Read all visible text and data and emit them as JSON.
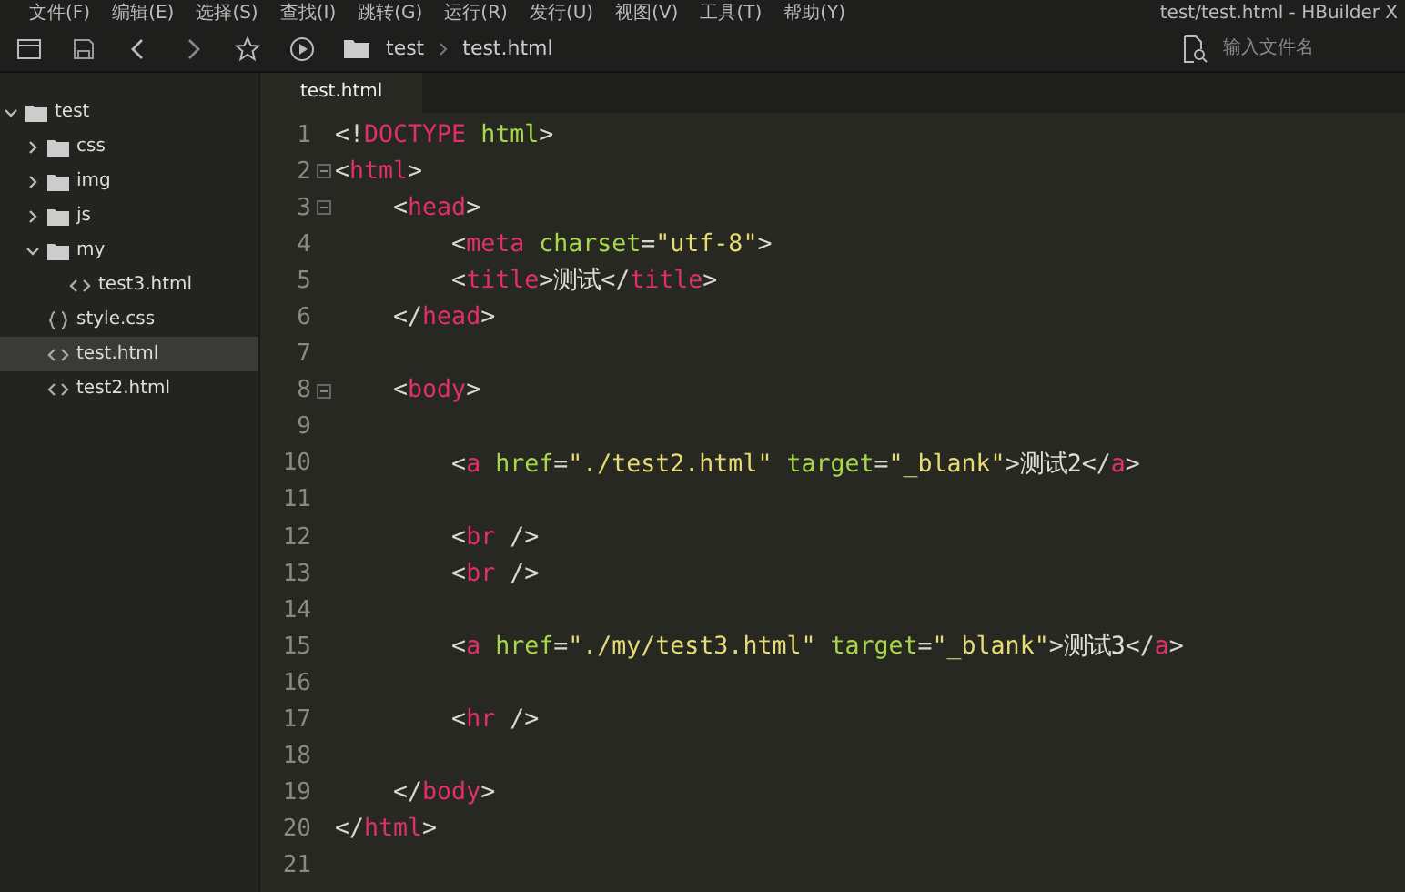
{
  "window": {
    "title": "test/test.html - HBuilder X"
  },
  "menu": [
    "文件(F)",
    "编辑(E)",
    "选择(S)",
    "查找(I)",
    "跳转(G)",
    "运行(R)",
    "发行(U)",
    "视图(V)",
    "工具(T)",
    "帮助(Y)"
  ],
  "toolbar": {
    "breadcrumb": [
      "test",
      "test.html"
    ],
    "search": {
      "placeholder": "输入文件名"
    }
  },
  "sidebar": {
    "items": [
      {
        "label": "test",
        "kind": "folder",
        "expanded": true,
        "selected": false,
        "children": [
          {
            "label": "css",
            "kind": "folder",
            "expanded": false,
            "selected": false
          },
          {
            "label": "img",
            "kind": "folder",
            "expanded": false,
            "selected": false
          },
          {
            "label": "js",
            "kind": "folder",
            "expanded": false,
            "selected": false
          },
          {
            "label": "my",
            "kind": "folder",
            "expanded": true,
            "selected": false,
            "children": [
              {
                "label": "test3.html",
                "kind": "html",
                "selected": false
              }
            ]
          },
          {
            "label": "style.css",
            "kind": "css",
            "selected": false
          },
          {
            "label": "test.html",
            "kind": "html",
            "selected": true
          },
          {
            "label": "test2.html",
            "kind": "html",
            "selected": false
          }
        ]
      }
    ]
  },
  "tabs": [
    {
      "label": "test.html",
      "selected": true
    }
  ],
  "editor": {
    "lines": [
      {
        "number": "1",
        "fold": false,
        "tokens": [
          {
            "kind": "punct",
            "text": "<!"
          },
          {
            "kind": "tag",
            "text": "DOCTYPE"
          },
          {
            "kind": "attr",
            "text": " html"
          },
          {
            "kind": "punct",
            "text": ">"
          }
        ]
      },
      {
        "number": "2",
        "fold": true,
        "tokens": [
          {
            "kind": "punct",
            "text": "<"
          },
          {
            "kind": "tag",
            "text": "html"
          },
          {
            "kind": "punct",
            "text": ">"
          }
        ]
      },
      {
        "number": "3",
        "fold": true,
        "tokens": [
          {
            "kind": "punct",
            "text": "    <"
          },
          {
            "kind": "tag",
            "text": "head"
          },
          {
            "kind": "punct",
            "text": ">"
          }
        ]
      },
      {
        "number": "4",
        "fold": false,
        "tokens": [
          {
            "kind": "punct",
            "text": "        <"
          },
          {
            "kind": "tag",
            "text": "meta"
          },
          {
            "kind": "attr",
            "text": " charset"
          },
          {
            "kind": "punct",
            "text": "="
          },
          {
            "kind": "string",
            "text": "\"utf-8\""
          },
          {
            "kind": "punct",
            "text": ">"
          }
        ]
      },
      {
        "number": "5",
        "fold": false,
        "tokens": [
          {
            "kind": "punct",
            "text": "        <"
          },
          {
            "kind": "tag",
            "text": "title"
          },
          {
            "kind": "punct",
            "text": ">"
          },
          {
            "kind": "plain",
            "text": "测试"
          },
          {
            "kind": "punct",
            "text": "</"
          },
          {
            "kind": "tag",
            "text": "title"
          },
          {
            "kind": "punct",
            "text": ">"
          }
        ]
      },
      {
        "number": "6",
        "fold": false,
        "tokens": [
          {
            "kind": "punct",
            "text": "    </"
          },
          {
            "kind": "tag",
            "text": "head"
          },
          {
            "kind": "punct",
            "text": ">"
          }
        ]
      },
      {
        "number": "7",
        "fold": false
      },
      {
        "number": "8",
        "fold": true,
        "tokens": [
          {
            "kind": "punct",
            "text": "    <"
          },
          {
            "kind": "tag",
            "text": "body"
          },
          {
            "kind": "punct",
            "text": ">"
          }
        ]
      },
      {
        "number": "9",
        "fold": false
      },
      {
        "number": "10",
        "fold": false,
        "tokens": [
          {
            "kind": "punct",
            "text": "        <"
          },
          {
            "kind": "tag",
            "text": "a"
          },
          {
            "kind": "attr",
            "text": " href"
          },
          {
            "kind": "punct",
            "text": "="
          },
          {
            "kind": "string",
            "text": "\"./test2.html\""
          },
          {
            "kind": "attr",
            "text": " target"
          },
          {
            "kind": "punct",
            "text": "="
          },
          {
            "kind": "string",
            "text": "\"_blank\""
          },
          {
            "kind": "punct",
            "text": ">"
          },
          {
            "kind": "plain",
            "text": "测试2"
          },
          {
            "kind": "punct",
            "text": "</"
          },
          {
            "kind": "tag",
            "text": "a"
          },
          {
            "kind": "punct",
            "text": ">"
          }
        ]
      },
      {
        "number": "11",
        "fold": false
      },
      {
        "number": "12",
        "fold": false,
        "tokens": [
          {
            "kind": "punct",
            "text": "        <"
          },
          {
            "kind": "tag",
            "text": "br"
          },
          {
            "kind": "punct",
            "text": " />"
          }
        ]
      },
      {
        "number": "13",
        "fold": false,
        "tokens": [
          {
            "kind": "punct",
            "text": "        <"
          },
          {
            "kind": "tag",
            "text": "br"
          },
          {
            "kind": "punct",
            "text": " />"
          }
        ]
      },
      {
        "number": "14",
        "fold": false
      },
      {
        "number": "15",
        "fold": false,
        "tokens": [
          {
            "kind": "punct",
            "text": "        <"
          },
          {
            "kind": "tag",
            "text": "a"
          },
          {
            "kind": "attr",
            "text": " href"
          },
          {
            "kind": "punct",
            "text": "="
          },
          {
            "kind": "string",
            "text": "\"./my/test3.html\""
          },
          {
            "kind": "attr",
            "text": " target"
          },
          {
            "kind": "punct",
            "text": "="
          },
          {
            "kind": "string",
            "text": "\"_blank\""
          },
          {
            "kind": "punct",
            "text": ">"
          },
          {
            "kind": "plain",
            "text": "测试3"
          },
          {
            "kind": "punct",
            "text": "</"
          },
          {
            "kind": "tag",
            "text": "a"
          },
          {
            "kind": "punct",
            "text": ">"
          }
        ]
      },
      {
        "number": "16",
        "fold": false
      },
      {
        "number": "17",
        "fold": false,
        "tokens": [
          {
            "kind": "punct",
            "text": "        <"
          },
          {
            "kind": "tag",
            "text": "hr"
          },
          {
            "kind": "punct",
            "text": " />"
          }
        ]
      },
      {
        "number": "18",
        "fold": false
      },
      {
        "number": "19",
        "fold": false,
        "tokens": [
          {
            "kind": "punct",
            "text": "    </"
          },
          {
            "kind": "tag",
            "text": "body"
          },
          {
            "kind": "punct",
            "text": ">"
          }
        ]
      },
      {
        "number": "20",
        "fold": false,
        "tokens": [
          {
            "kind": "punct",
            "text": "</"
          },
          {
            "kind": "tag",
            "text": "html"
          },
          {
            "kind": "punct",
            "text": ">"
          }
        ]
      },
      {
        "number": "21",
        "fold": false
      }
    ]
  }
}
